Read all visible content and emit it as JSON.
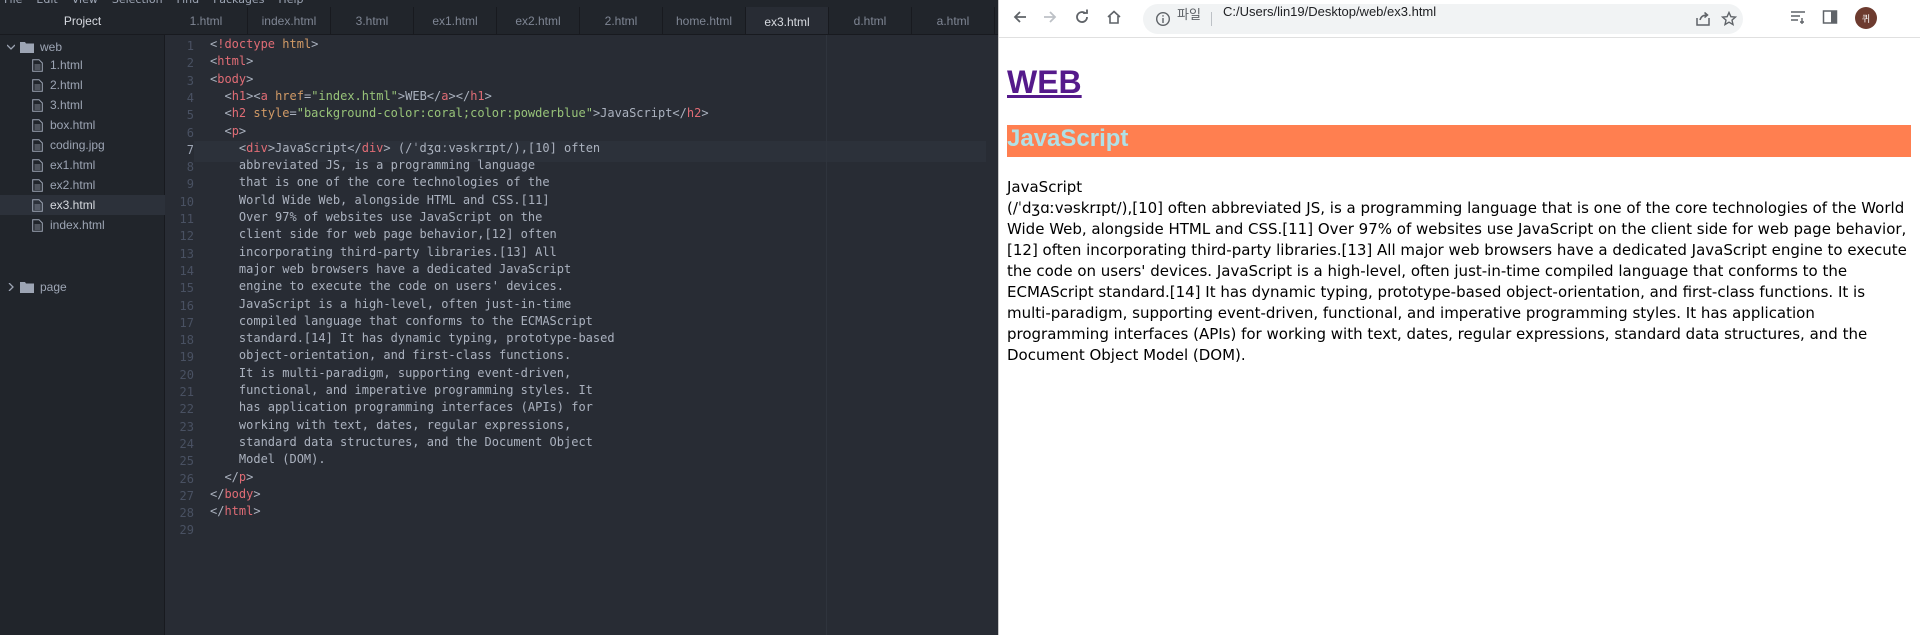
{
  "editor": {
    "menu": [
      "File",
      "Edit",
      "View",
      "Selection",
      "Find",
      "Packages",
      "Help"
    ],
    "tree": {
      "header": "Project",
      "root": "web",
      "files": [
        "1.html",
        "2.html",
        "3.html",
        "box.html",
        "coding.jpg",
        "ex1.html",
        "ex2.html",
        "ex3.html",
        "index.html"
      ],
      "selected_file": "ex3.html",
      "collapsed_folder": "page"
    },
    "tabs": [
      "1.html",
      "index.html",
      "3.html",
      "ex1.html",
      "ex2.html",
      "2.html",
      "home.html",
      "ex3.html",
      "d.html",
      "a.html"
    ],
    "active_tab": "ex3.html",
    "current_line": 7,
    "code_lines": [
      "<!doctype html>",
      "<html>",
      "<body>",
      "  <h1><a href=\"index.html\">WEB</a></h1>",
      "  <h2 style=\"background-color:coral;color:powderblue\">JavaScript</h2>",
      "  <p>",
      "    <div>JavaScript</div> (/ˈdʒɑːvəskrɪpt/),[10] often",
      "    abbreviated JS, is a programming language",
      "    that is one of the core technologies of the",
      "    World Wide Web, alongside HTML and CSS.[11]",
      "    Over 97% of websites use JavaScript on the",
      "    client side for web page behavior,[12] often",
      "    incorporating third-party libraries.[13] All",
      "    major web browsers have a dedicated JavaScript",
      "    engine to execute the code on users' devices.",
      "    JavaScript is a high-level, often just-in-time",
      "    compiled language that conforms to the ECMAScript",
      "    standard.[14] It has dynamic typing, prototype-based",
      "    object-orientation, and first-class functions.",
      "    It is multi-paradigm, supporting event-driven,",
      "    functional, and imperative programming styles. It",
      "    has application programming interfaces (APIs) for",
      "    working with text, dates, regular expressions,",
      "    standard data structures, and the Document Object",
      "    Model (DOM).",
      "  </p>",
      "</body>",
      "</html>",
      ""
    ]
  },
  "browser": {
    "scheme_label": "파일",
    "url": "C:/Users/lin19/Desktop/web/ex3.html",
    "avatar_initial": "퀴",
    "icons": [
      "back-icon",
      "forward-icon",
      "reload-icon",
      "home-icon",
      "info-icon",
      "share-icon",
      "star-icon",
      "reading-list-icon",
      "side-panel-icon"
    ],
    "page": {
      "h1": "WEB",
      "h2": "JavaScript",
      "h2_bg": "#ff7f50",
      "h2_color": "#b0e0e6",
      "div_text": "JavaScript",
      "paragraph": "(/ˈdʒɑːvəskrɪpt/),[10] often abbreviated JS, is a programming language that is one of the core technologies of the World Wide Web, alongside HTML and CSS.[11] Over 97% of websites use JavaScript on the client side for web page behavior,[12] often incorporating third-party libraries.[13] All major web browsers have a dedicated JavaScript engine to execute the code on users' devices. JavaScript is a high-level, often just-in-time compiled language that conforms to the ECMAScript standard.[14] It has dynamic typing, prototype-based object-orientation, and first-class functions. It is multi-paradigm, supporting event-driven, functional, and imperative programming styles. It has application programming interfaces (APIs) for working with text, dates, regular expressions, standard data structures, and the Document Object Model (DOM)."
    }
  },
  "colors": {
    "editor_bg": "#282c34",
    "panel_bg": "#21252b",
    "tag": "#e06c75",
    "attr": "#d19a66",
    "string": "#98c379",
    "link_visited": "#551a8b"
  }
}
